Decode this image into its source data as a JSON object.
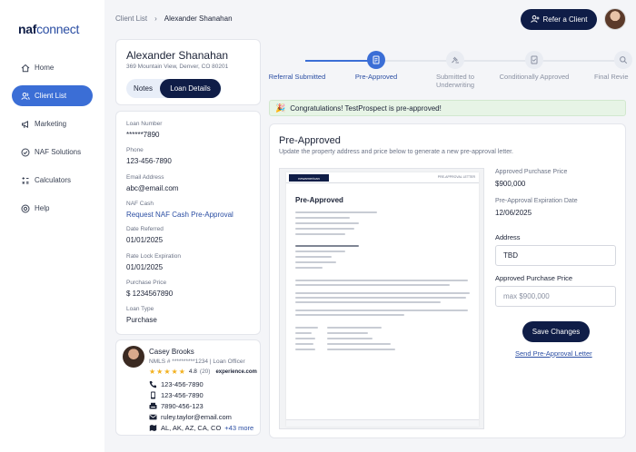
{
  "brand": {
    "logo_naf": "naf",
    "logo_connect": "connect"
  },
  "sidebar": {
    "items": [
      {
        "label": "Home",
        "icon": "home-icon"
      },
      {
        "label": "Client List",
        "icon": "users-icon",
        "active": true
      },
      {
        "label": "Marketing",
        "icon": "megaphone-icon"
      },
      {
        "label": "NAF Solutions",
        "icon": "check-circle-icon"
      },
      {
        "label": "Calculators",
        "icon": "calculator-icon"
      },
      {
        "label": "Help",
        "icon": "help-icon"
      }
    ]
  },
  "header": {
    "breadcrumb": {
      "parent": "Client List",
      "current": "Alexander Shanahan"
    },
    "refer_button": "Refer a Client"
  },
  "profile": {
    "name": "Alexander Shanahan",
    "address": "369 Mountain View, Denver, CO 80201",
    "tabs": {
      "notes": "Notes",
      "details": "Loan Details"
    }
  },
  "loan": {
    "fields": [
      {
        "label": "Loan Number",
        "value": "******7890"
      },
      {
        "label": "Phone",
        "value": "123-456-7890"
      },
      {
        "label": "Email Address",
        "value": "abc@email.com"
      },
      {
        "label": "NAF Cash",
        "value": "Request NAF Cash Pre-Approval",
        "link": true
      },
      {
        "label": "Date Referred",
        "value": "01/01/2025"
      },
      {
        "label": "Rate Lock Expiration",
        "value": "01/01/2025"
      },
      {
        "label": "Purchase Price",
        "value": "$ 1234567890"
      },
      {
        "label": "Loan Type",
        "value": "Purchase"
      }
    ]
  },
  "officer": {
    "name": "Casey Brooks",
    "nmls": "NMLS # **********1234 | Loan Officer",
    "rating": "4.8",
    "rating_value": 4.8,
    "rating_count": "(20)",
    "experience_brand": "experience.com",
    "phone1": "123-456-7890",
    "phone2": "123-456-7890",
    "phone3": "7890-456-123",
    "email": "ruley.taylor@email.com",
    "states": "AL, AK, AZ, CA, CO",
    "more": "+43 more"
  },
  "stepper": {
    "steps": [
      {
        "label": "Referral Submitted",
        "state": "done"
      },
      {
        "label": "Pre-Approved",
        "state": "active"
      },
      {
        "label": "Submitted to Underwriting",
        "state": "pending"
      },
      {
        "label": "Conditionally Approved",
        "state": "pending"
      },
      {
        "label": "Final Revie",
        "state": "pending"
      }
    ]
  },
  "banner": {
    "text": "Congratulations! TestProspect is pre-approved!"
  },
  "preapproval": {
    "title": "Pre-Approved",
    "subtitle": "Update the property address and price below to generate a new pre-approval letter.",
    "approved_price_label": "Approved Purchase Price",
    "approved_price_value": "$900,000",
    "expiration_label": "Pre-Approval Expiration Date",
    "expiration_value": "12/06/2025",
    "address_label": "Address",
    "address_value": "TBD",
    "price_input_label": "Approved Purchase Price",
    "price_input_placeholder": "max $900,000",
    "save_button": "Save Changes",
    "send_link": "Send Pre-Approval Letter"
  },
  "letter": {
    "brand": "newamerican",
    "header_right": "PRE-APPROVAL LETTER",
    "title": "Pre-Approved"
  },
  "colors": {
    "navy": "#0f1d47",
    "accent": "#3b6ed6",
    "link": "#2b4ea3",
    "success_bg": "#e7f4e6"
  }
}
